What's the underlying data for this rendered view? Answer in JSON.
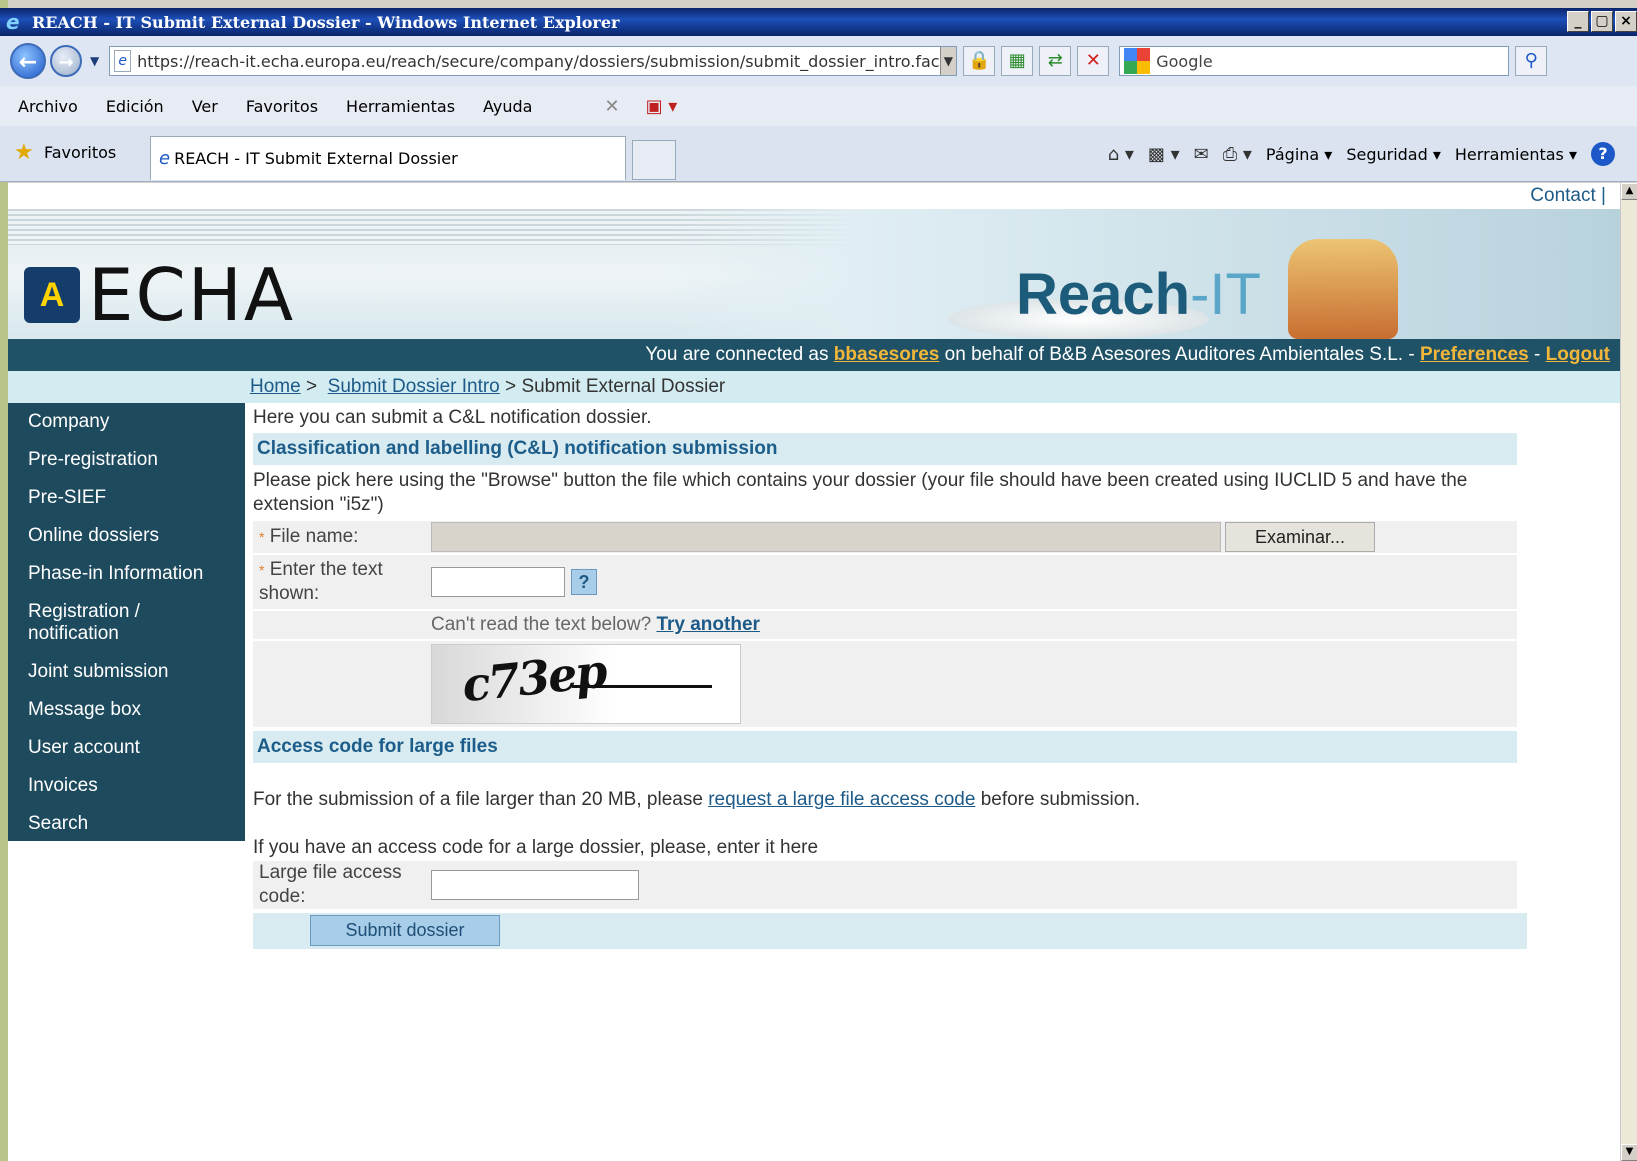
{
  "window": {
    "title": "REACH - IT Submit External Dossier - Windows Internet Explorer",
    "controls": [
      "_",
      "Ё",
      "×"
    ]
  },
  "address_bar": {
    "url": "https://reach-it.echa.europa.eu/reach/secure/company/dossiers/submission/submit_dossier_intro.fac",
    "search_placeholder": "Google"
  },
  "menu": {
    "items": [
      "Archivo",
      "Edición",
      "Ver",
      "Favoritos",
      "Herramientas",
      "Ayuda"
    ]
  },
  "favorites_bar": {
    "favorites_label": "Favoritos",
    "tab_title": "REACH - IT Submit External Dossier",
    "commands": [
      "Página",
      "Seguridad",
      "Herramientas"
    ]
  },
  "page": {
    "contact_link": "Contact",
    "logo_text": "ECHA",
    "product_name_main": "Reach",
    "product_name_suffix": "-IT",
    "user_bar": {
      "prefix": "You are connected as",
      "username": "bbasesores",
      "middle": "on behalf of B&B Asesores Auditores Ambientales S.L. -",
      "preferences": "Preferences",
      "separator": "-",
      "logout": "Logout"
    },
    "breadcrumb": {
      "home": "Home",
      "sep1": ">",
      "intro": "Submit Dossier Intro",
      "sep2": ">",
      "current": "Submit External Dossier"
    },
    "sidebar": [
      "Company",
      "Pre-registration",
      "Pre-SIEF",
      "Online dossiers",
      "Phase-in Information",
      "Registration / notification",
      "Joint submission",
      "Message box",
      "User account",
      "Invoices",
      "Search"
    ],
    "intro_text": "Here you can submit a C&L notification dossier.",
    "cl_section_title": "Classification and labelling (C&L) notification submission",
    "instructions": "Please pick here using the \"Browse\" button the file which contains your dossier (your file should have been created using IUCLID 5 and have the extension \"i5z\")",
    "file_label": "File name:",
    "browse_button": "Examinar...",
    "captcha_label": "Enter the text shown:",
    "captcha_help": "?",
    "captcha_hint": "Can't read the text below?",
    "captcha_try_another": "Try another",
    "captcha_image_text": "c73ep",
    "access_section_title": "Access code for large files",
    "large_file_text_before": "For the submission of a file larger than 20 MB, please",
    "large_file_link": "request a large file access code",
    "large_file_text_after": "before submission.",
    "access_code_prompt": "If you have an access code for a large dossier, please, enter it here",
    "access_code_label": "Large file access code:",
    "submit_button": "Submit dossier"
  }
}
